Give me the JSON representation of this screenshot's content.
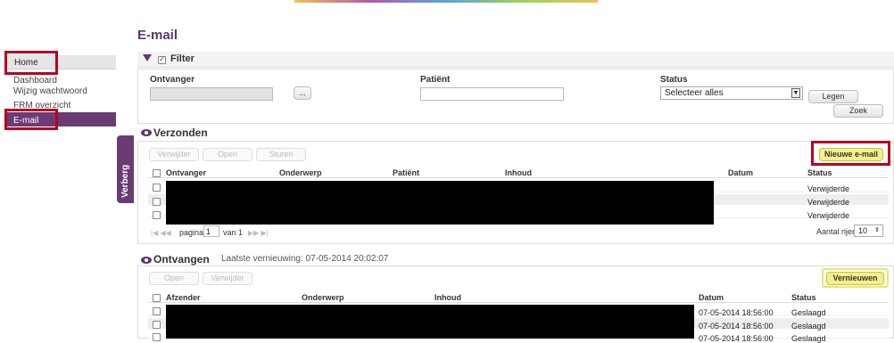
{
  "sidebar": {
    "home": "Home",
    "items": [
      {
        "label": "Dashboard"
      },
      {
        "label": "Wijzig wachtwoord"
      },
      {
        "label": "FRM overzicht"
      },
      {
        "label": "E-mail"
      }
    ],
    "hide_tab": "Verberg"
  },
  "page": {
    "title": "E-mail"
  },
  "filter": {
    "label": "Filter",
    "ontvanger_label": "Ontvanger",
    "browse_button": "...",
    "patient_label": "Patiënt",
    "status_label": "Status",
    "status_value": "Selecteer alles",
    "clear_button": "Legen",
    "search_button": "Zoek"
  },
  "sent": {
    "title": "Verzonden",
    "buttons": {
      "delete": "Verwijder",
      "open": "Open",
      "send": "Sturen"
    },
    "new_button": "Nieuwe e-mail",
    "columns": [
      "Ontvanger",
      "Onderwerp",
      "Patiënt",
      "Inhoud",
      "Datum",
      "Status"
    ],
    "rows": [
      {
        "status": "Verwijderde"
      },
      {
        "status": "Verwijderde"
      },
      {
        "status": "Verwijderde"
      }
    ],
    "pager": {
      "page_label": "pagina",
      "page_value": "1",
      "of_label": "van 1",
      "rows_label": "Aantal rijen",
      "rows_value": "10"
    }
  },
  "received": {
    "title": "Ontvangen",
    "last_refresh": "Laatste vernieuwing: 07-05-2014 20:02:07",
    "buttons": {
      "open": "Open",
      "delete": "Verwijder"
    },
    "refresh_button": "Vernieuwen",
    "columns": [
      "Afzender",
      "Onderwerp",
      "Inhoud",
      "Datum",
      "Status"
    ],
    "rows": [
      {
        "date": "07-05-2014 18:56:00",
        "status": "Geslaagd"
      },
      {
        "date": "07-05-2014 18:56:00",
        "status": "Geslaagd"
      },
      {
        "date": "07-05-2014 18:56:00",
        "status": "Geslaagd"
      }
    ]
  }
}
